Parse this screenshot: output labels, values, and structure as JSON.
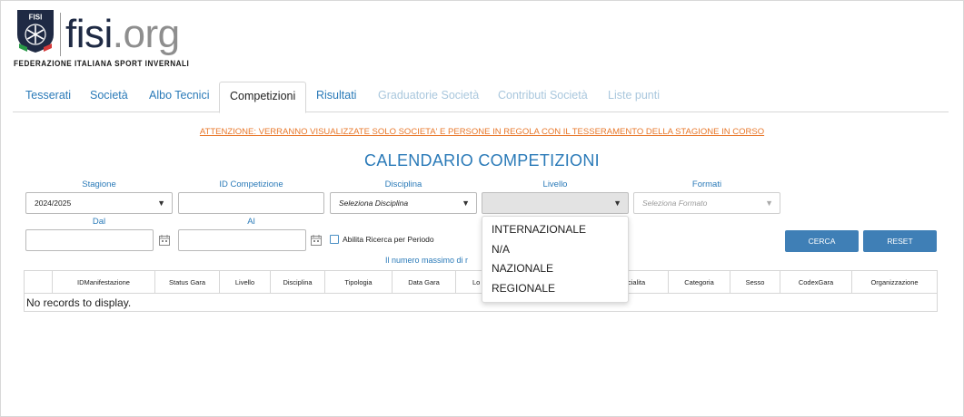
{
  "header": {
    "logo_badge": "FISI",
    "logo_name": "fisi",
    "logo_dot": ".",
    "logo_tld": "org",
    "federation": "FEDERAZIONE ITALIANA SPORT INVERNALI",
    "brand_color": "#1f2a44"
  },
  "tabs": [
    {
      "label": "Tesserati",
      "state": "normal"
    },
    {
      "label": "Società",
      "state": "normal"
    },
    {
      "label": "Albo Tecnici",
      "state": "normal"
    },
    {
      "label": "Competizioni",
      "state": "active"
    },
    {
      "label": "Risultati",
      "state": "normal"
    },
    {
      "label": "Graduatorie Società",
      "state": "disabled"
    },
    {
      "label": "Contributi Società",
      "state": "disabled"
    },
    {
      "label": "Liste punti",
      "state": "disabled"
    }
  ],
  "warning": "ATTENZIONE: VERRANNO VISUALIZZATE SOLO SOCIETA' E PERSONE IN REGOLA CON IL TESSERAMENTO DELLA STAGIONE IN CORSO",
  "title": "CALENDARIO COMPETIZIONI",
  "filters": {
    "stagione": {
      "label": "Stagione",
      "value": "2024/2025"
    },
    "id_competizione": {
      "label": "ID Competizione",
      "value": ""
    },
    "disciplina": {
      "label": "Disciplina",
      "placeholder": "Seleziona Disciplina"
    },
    "livello": {
      "label": "Livello",
      "value": "",
      "open": true
    },
    "formati": {
      "label": "Formati",
      "placeholder": "Seleziona Formato",
      "disabled": true
    },
    "dal": {
      "label": "Dal",
      "value": ""
    },
    "al": {
      "label": "Al",
      "value": ""
    },
    "period_checkbox": {
      "label": "Abilita Ricerca per Periodo",
      "checked": false
    }
  },
  "buttons": {
    "search": "CERCA",
    "reset": "RESET"
  },
  "note_prefix": "Il numero massimo di r",
  "table": {
    "columns": [
      "",
      "IDManifestazione",
      "Status Gara",
      "Livello",
      "Disciplina",
      "Tipologia",
      "Data Gara",
      "Lo",
      "cialita",
      "Categoria",
      "Sesso",
      "CodexGara",
      "Organizzazione"
    ],
    "empty_text": "No records to display."
  },
  "livello_options": [
    "INTERNAZIONALE",
    "N/A",
    "NAZIONALE",
    "REGIONALE"
  ],
  "colors": {
    "link": "#2a7ab8",
    "warning": "#e8772a",
    "button": "#3f7fb6"
  }
}
